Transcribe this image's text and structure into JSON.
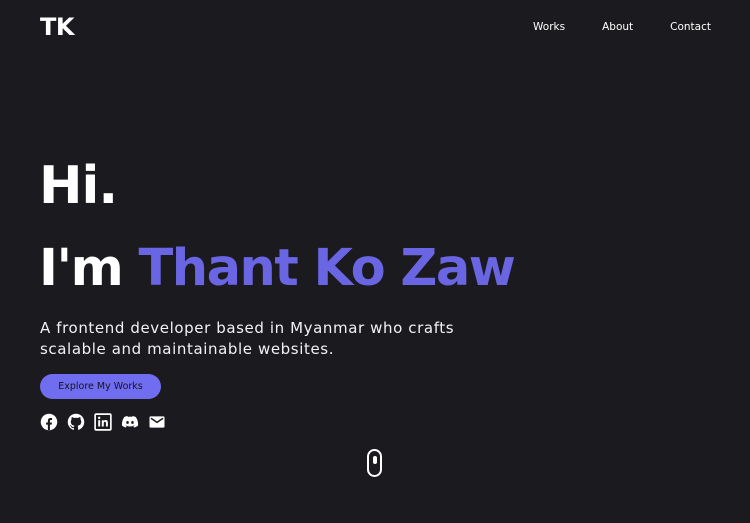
{
  "header": {
    "logo": "TK",
    "nav": [
      "Works",
      "About",
      "Contact"
    ]
  },
  "hero": {
    "greeting": "Hi.",
    "name_prefix": "I'm",
    "name": "Thant Ko Zaw",
    "tagline": "A frontend developer based in Myanmar who crafts scalable and maintainable websites.",
    "cta_label": "Explore My Works"
  },
  "social_icons": [
    "facebook-icon",
    "github-icon",
    "linkedin-icon",
    "discord-icon",
    "email-icon"
  ],
  "scroll_indicator_icon": "mouse-scroll-icon",
  "colors": {
    "background": "#1b1a1e",
    "accent": "#6a66e3",
    "button": "#716df0",
    "text": "#ffffff"
  }
}
